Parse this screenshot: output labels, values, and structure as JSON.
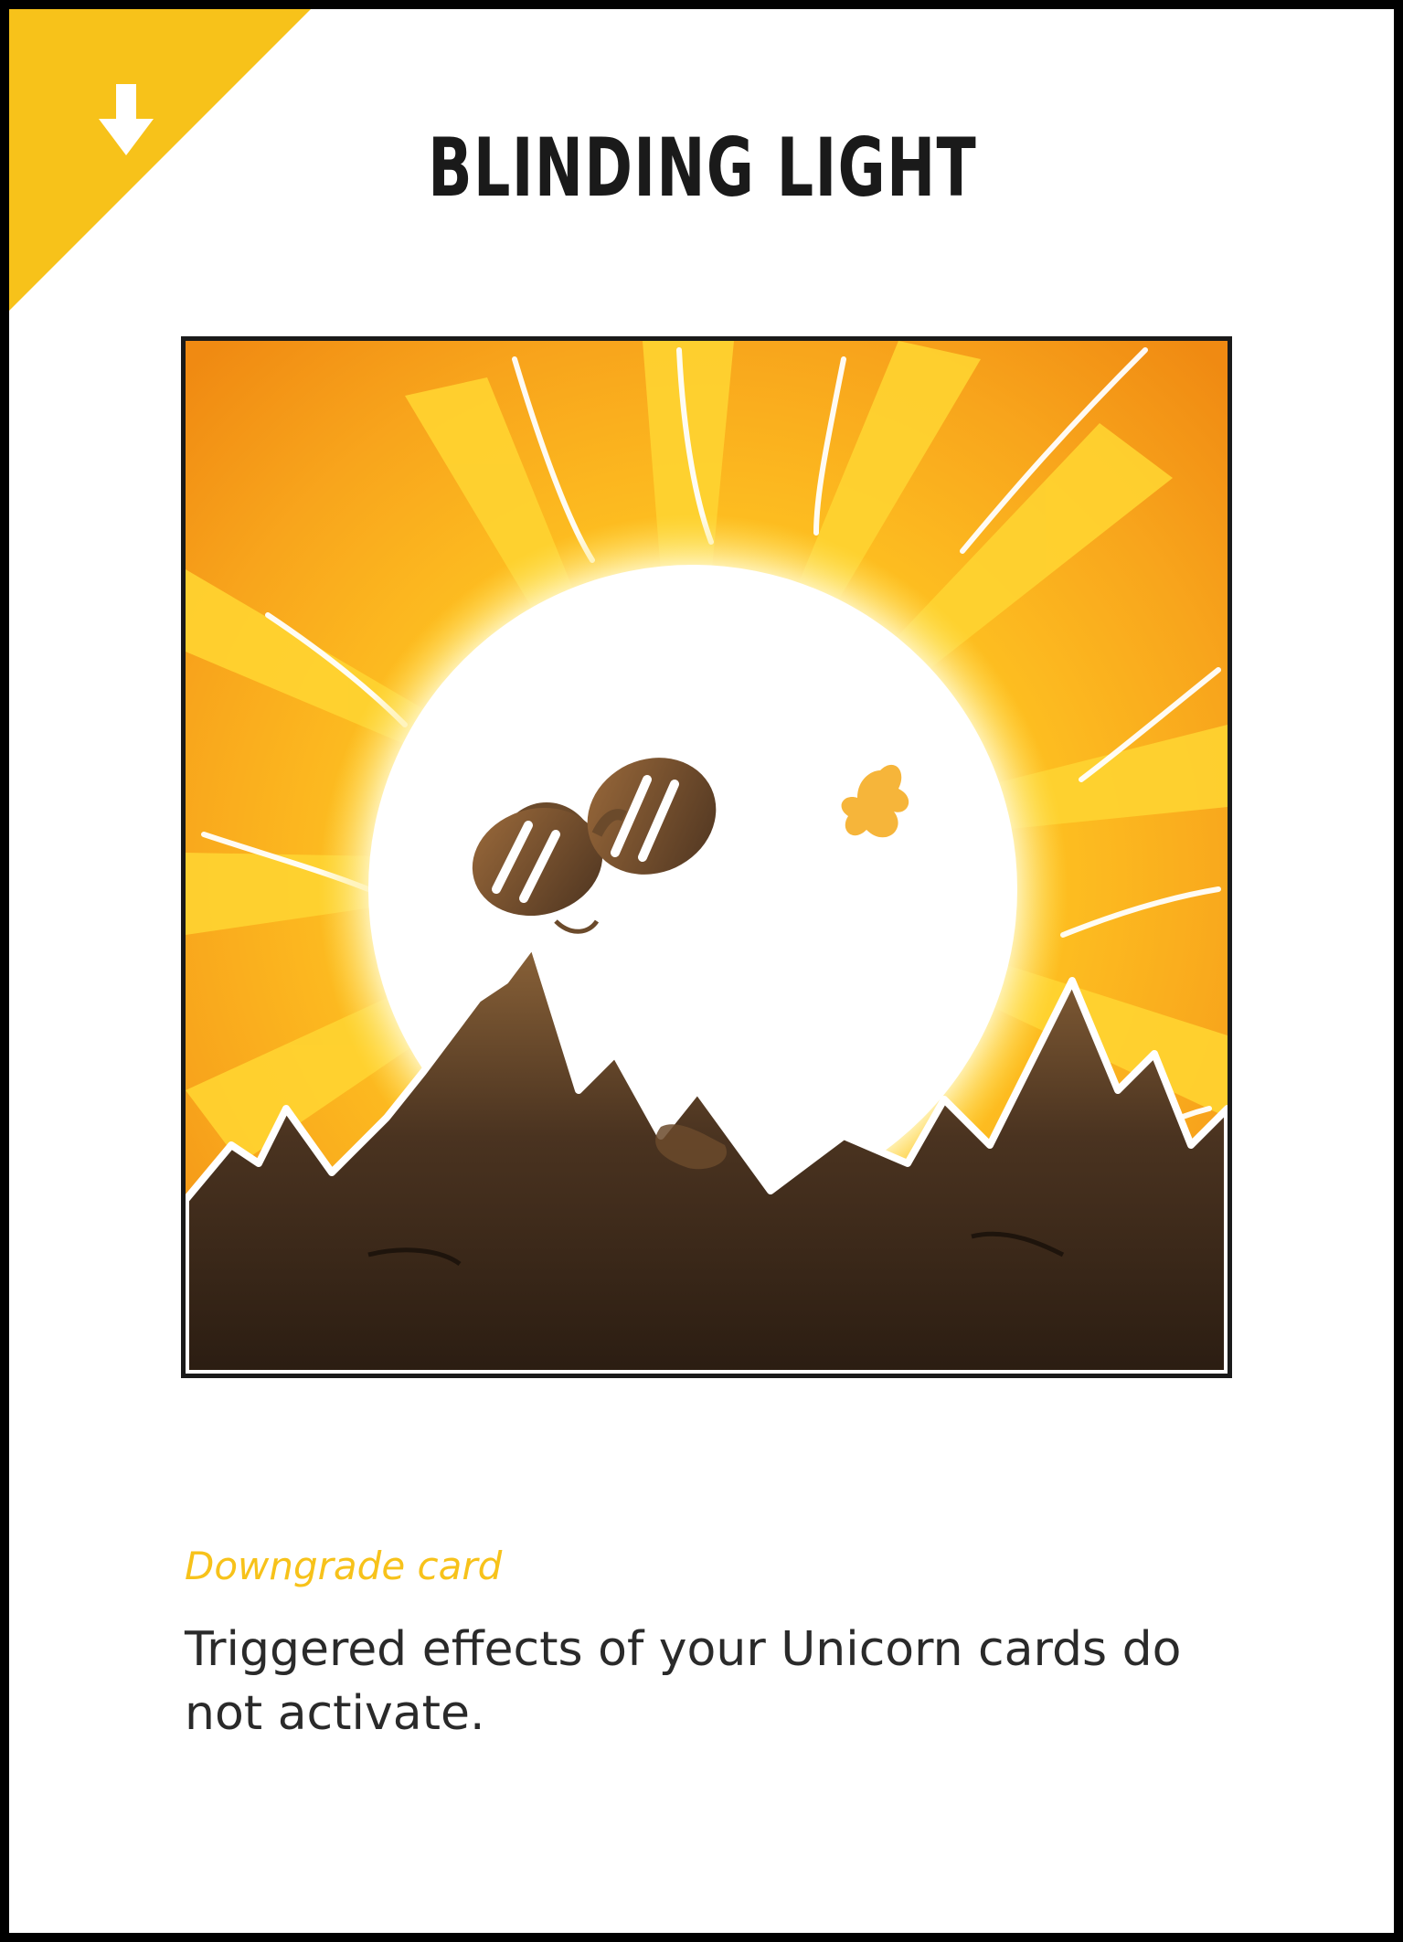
{
  "card": {
    "title": "BLINDING LIGHT",
    "type_label": "Downgrade card",
    "effect_text": "Triggered effects of your Unicorn cards do not activate.",
    "corner_icon": "down-arrow-icon",
    "accent_color": "#f7c21a",
    "artwork": "sun-with-sunglasses-over-mountains"
  }
}
